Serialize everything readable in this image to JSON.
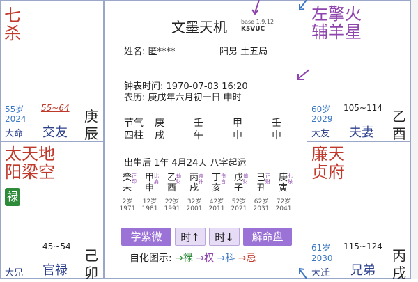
{
  "colors": {
    "red": "#c0392b",
    "purple": "#8e44ad",
    "blue": "#3b78c4",
    "accent": "#9b73d6",
    "border": "#9aa7c8"
  },
  "top_left": {
    "stars": "七杀",
    "age_range": "55岁",
    "year": "2024",
    "da_ming": "大命",
    "range_red": "55~64",
    "palace": "交友",
    "stem": "庚",
    "branch": "辰"
  },
  "mid_left": {
    "stars1": "太天地",
    "stars2": "阳梁空",
    "lu_badge": "禄",
    "range": "45~54",
    "da": "大兄",
    "palace": "官禄",
    "stem": "己",
    "branch": "卯"
  },
  "top_right": {
    "stars1": "左擎火",
    "stars2": "辅羊星",
    "age": "60岁",
    "year": "2029",
    "da": "大友",
    "range": "105~114",
    "palace": "夫妻",
    "stem": "乙",
    "branch": "酉"
  },
  "mid_right": {
    "stars1": "廉天",
    "stars2": "贞府",
    "age": "61岁",
    "year": "2030",
    "da": "大迁",
    "range": "115~124",
    "palace": "兄弟",
    "stem": "丙",
    "branch": "戌"
  },
  "center": {
    "app_title": "文墨天机",
    "version": "base 1.9.12",
    "edition": "K5VUC",
    "name_label": "姓名: 匿****",
    "gender_bureau": "阳男 土五局",
    "clock_time": "钟表时间:  1970-07-03  16:20",
    "lunar": "农历: 庚戌年六月初一日 申时",
    "jieqi_label": "节气",
    "sizhu_label": "四柱",
    "jieqi_pillars": [
      [
        "庚",
        "戌"
      ],
      [
        "壬",
        "午"
      ],
      [
        "甲",
        "申"
      ],
      [
        "壬",
        "申"
      ]
    ],
    "luck_start": "出生后 1年 4月24天 八字起运",
    "dayun": [
      {
        "stem": "癸",
        "branch": "未",
        "god1": "正",
        "god2": "印",
        "age": "2岁",
        "year": "1971"
      },
      {
        "stem": "甲",
        "branch": "申",
        "god1": "比",
        "god2": "肩",
        "age": "12岁",
        "year": "1981"
      },
      {
        "stem": "乙",
        "branch": "酉",
        "god1": "劫",
        "god2": "财",
        "age": "22岁",
        "year": "1991"
      },
      {
        "stem": "丙",
        "branch": "戌",
        "god1": "食",
        "god2": "神",
        "age": "32岁",
        "year": "2001"
      },
      {
        "stem": "丁",
        "branch": "亥",
        "god1": "伤",
        "god2": "官",
        "age": "42岁",
        "year": "2011"
      },
      {
        "stem": "戊",
        "branch": "子",
        "god1": "偏",
        "god2": "财",
        "age": "52岁",
        "year": "2021"
      },
      {
        "stem": "己",
        "branch": "丑",
        "god1": "正",
        "god2": "财",
        "age": "62岁",
        "year": "2031"
      },
      {
        "stem": "庚",
        "branch": "寅",
        "god1": "七",
        "god2": "杀",
        "age": "72岁",
        "year": "2041"
      }
    ],
    "buttons": {
      "xuezi": "学紫微",
      "time_up": "时↑",
      "time_down": "时↓",
      "jieming": "解命盘"
    },
    "hua_label": "自化图示:",
    "hua_items": [
      {
        "arrow": "→",
        "text": "禄"
      },
      {
        "arrow": "→",
        "text": "权"
      },
      {
        "arrow": "→",
        "text": "科"
      },
      {
        "arrow": "→",
        "text": "忌"
      }
    ]
  }
}
